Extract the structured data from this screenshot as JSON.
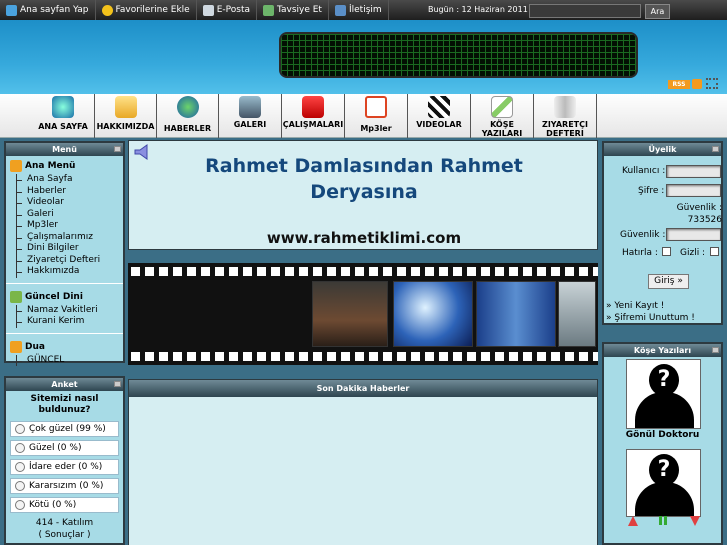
{
  "topbar": {
    "links": [
      {
        "label": "Ana sayfan Yap",
        "icon": "home-icon"
      },
      {
        "label": "Favorilerine Ekle",
        "icon": "star-icon"
      },
      {
        "label": "E-Posta",
        "icon": "email-icon"
      },
      {
        "label": "Tavsiye Et",
        "icon": "recommend-icon"
      },
      {
        "label": "İletişim",
        "icon": "contact-icon"
      }
    ],
    "date": "Bugün : 12 Haziran 2011",
    "search_value": "",
    "search_button": "Ara"
  },
  "header": {
    "rss": "RSS"
  },
  "nav": [
    {
      "label": "ANA SAYFA",
      "icon": "globe-icon"
    },
    {
      "label": "HAKKIMIZDA",
      "icon": "folder-icon"
    },
    {
      "label": "HABERLER",
      "icon": "world-icon"
    },
    {
      "label": "GALERI",
      "icon": "gallery-icon"
    },
    {
      "label": "ÇALIŞMALARI",
      "icon": "gift-icon"
    },
    {
      "label": "Mp3ler",
      "icon": "flash-icon"
    },
    {
      "label": "VIDEOLAR",
      "icon": "clapper-icon"
    },
    {
      "label": "KÖŞE YAZILARI",
      "icon": "pencil-icon"
    },
    {
      "label": "ZIYARETÇI DEFTERI",
      "icon": "book-icon"
    }
  ],
  "menu": {
    "title": "Menü",
    "sections": [
      {
        "title": "Ana Menü",
        "items": [
          "Ana Sayfa",
          "Haberler",
          "Videolar",
          "Galeri",
          "Mp3ler",
          "Çalışmalarımız",
          "Dini Bilgiler",
          "Ziyaretçi Defteri",
          "Hakkımızda"
        ]
      },
      {
        "title": "Güncel Dini",
        "items": [
          "Namaz Vakitleri",
          "Kurani Kerim"
        ]
      },
      {
        "title": "Dua",
        "items": [
          "GÜNCEL"
        ]
      }
    ]
  },
  "poll": {
    "title": "Anket",
    "question": "Sitemizi nasıl buldunuz?",
    "options": [
      "Çok güzel (99 %)",
      "Güzel (0 %)",
      "İdare eder (0 %)",
      "Kararsızım (0 %)",
      "Kötü (0 %)"
    ],
    "participants": "414 - Katılım",
    "results": "( Sonuçlar )"
  },
  "center": {
    "title": "Rahmet Damlasından Rahmet Deryasına",
    "url": "www.rahmetiklimi.com",
    "news_title": "Son Dakika Haberler"
  },
  "membership": {
    "title": "Üyelik",
    "username_label": "Kullanıcı :",
    "password_label": "Şifre :",
    "security_label": "Güvenlik : 733526",
    "security_input_label": "Güvenlik :",
    "remember_label": "Hatırla :",
    "hidden_label": "Gizli :",
    "login_button": "Giriş »",
    "register": "» Yeni Kayıt !",
    "forgot": "» Şifremi Unuttum !"
  },
  "columns": {
    "title": "Köşe Yazıları",
    "author1": "Gönül Doktoru"
  },
  "colors": {
    "accent": "#1d8fc8",
    "panel": "#a7dbe6",
    "title": "#15487c"
  }
}
